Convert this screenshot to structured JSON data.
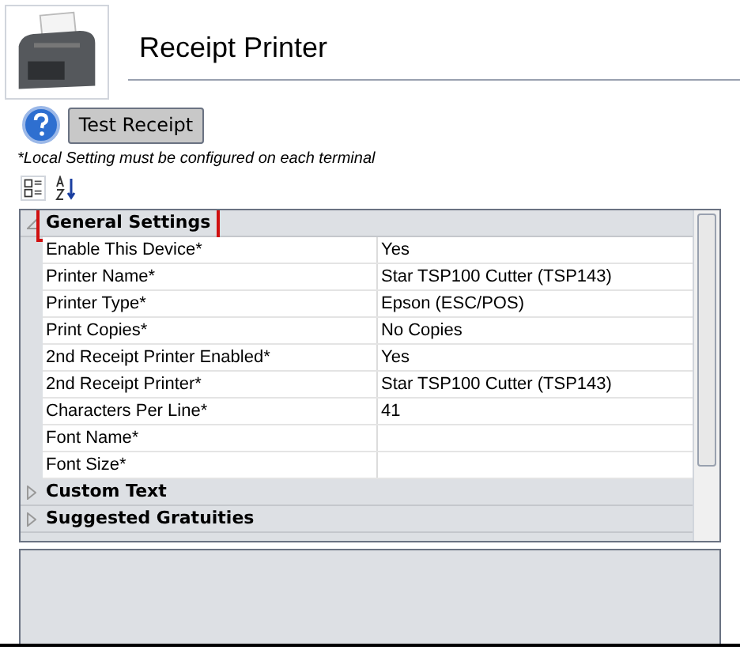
{
  "header": {
    "title": "Receipt Printer"
  },
  "toolbar": {
    "test_button": "Test Receipt",
    "note": "*Local Setting must be configured on each terminal"
  },
  "property_grid": {
    "groups": [
      {
        "label": "General Settings",
        "expanded": true,
        "highlighted": true,
        "rows": [
          {
            "name": "Enable This Device*",
            "value": "Yes"
          },
          {
            "name": "Printer Name*",
            "value": "Star TSP100 Cutter (TSP143)"
          },
          {
            "name": "Printer Type*",
            "value": "Epson (ESC/POS)"
          },
          {
            "name": "Print Copies*",
            "value": "No Copies"
          },
          {
            "name": "2nd Receipt Printer Enabled*",
            "value": "Yes"
          },
          {
            "name": "2nd Receipt Printer*",
            "value": "Star TSP100 Cutter (TSP143)"
          },
          {
            "name": "Characters Per Line*",
            "value": "41"
          },
          {
            "name": "Font Name*"
          },
          {
            "name": "Font Size*"
          }
        ]
      },
      {
        "label": "Custom Text",
        "expanded": false,
        "highlighted": false
      },
      {
        "label": "Suggested Gratuities",
        "expanded": false,
        "highlighted": false
      }
    ]
  }
}
